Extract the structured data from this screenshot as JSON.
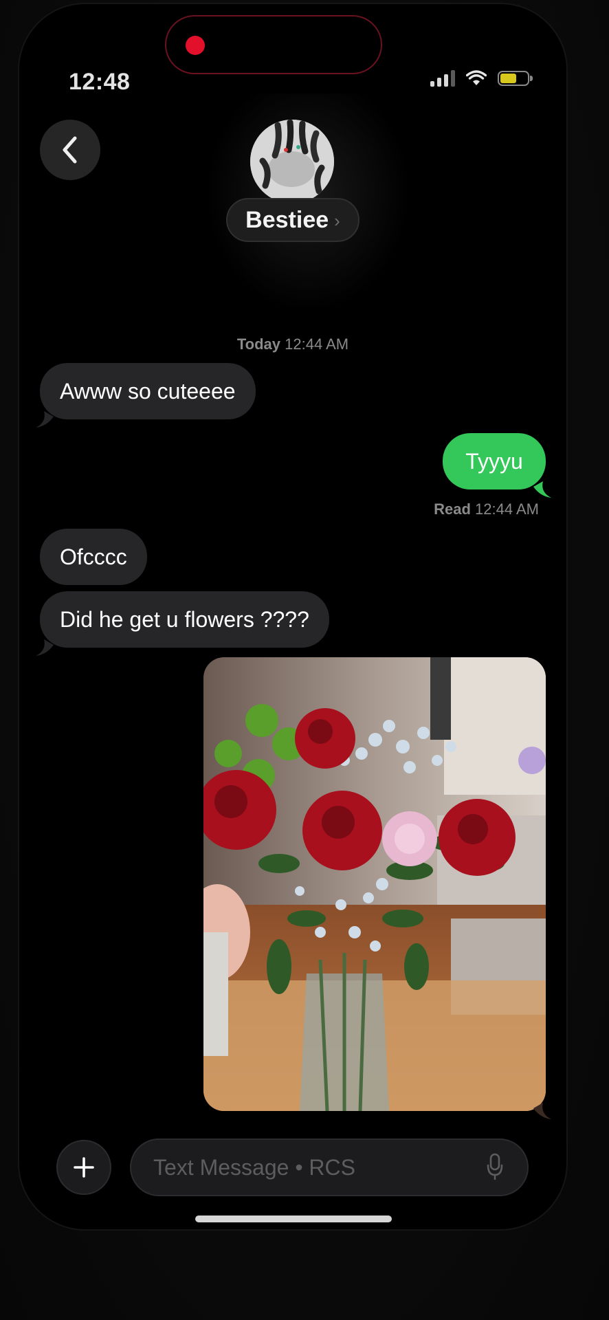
{
  "status_bar": {
    "time": "12:48",
    "signal_icon": "cellular-signal-icon",
    "wifi_icon": "wifi-icon",
    "battery_icon": "battery-icon",
    "battery_color": "#d8c81e",
    "recording_indicator_color": "#e3102c"
  },
  "header": {
    "back_icon": "chevron-left-icon",
    "contact_name": "Bestiee",
    "contact_chevron": "›"
  },
  "conversation": {
    "timestamp_day": "Today",
    "timestamp_time": "12:44 AM",
    "messages": [
      {
        "direction": "incoming",
        "text": "Awww so cuteeee"
      },
      {
        "direction": "outgoing",
        "text": "Tyyyu"
      },
      {
        "direction": "incoming",
        "text": "Ofcccc"
      },
      {
        "direction": "incoming",
        "text": "Did he get u flowers ????"
      },
      {
        "direction": "outgoing",
        "type": "photo"
      }
    ],
    "read_label": "Read",
    "read_time": "12:44 AM",
    "outgoing_color": "#34c759",
    "incoming_color": "#262628"
  },
  "composer": {
    "plus_icon": "plus-icon",
    "placeholder": "Text Message • RCS",
    "value": "",
    "mic_icon": "microphone-icon"
  }
}
